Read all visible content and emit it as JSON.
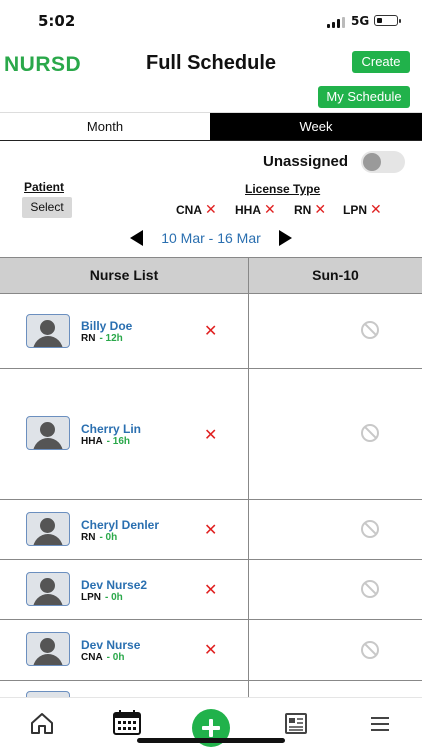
{
  "status_bar": {
    "time": "5:02",
    "network": "5G"
  },
  "header": {
    "brand": "NURSD",
    "title": "Full Schedule",
    "create_label": "Create",
    "my_schedule_label": "My Schedule"
  },
  "tabs": [
    {
      "label": "Month",
      "active": false
    },
    {
      "label": "Week",
      "active": true
    }
  ],
  "filters": {
    "unassigned_label": "Unassigned",
    "unassigned_on": false,
    "patient_label": "Patient",
    "select_label": "Select",
    "license_label": "License Type",
    "license_types": [
      "CNA",
      "HHA",
      "RN",
      "LPN"
    ]
  },
  "date_nav": {
    "range": "10 Mar - 16 Mar"
  },
  "grid": {
    "nurse_col_header": "Nurse List",
    "day_col_header": "Sun-10",
    "nurses": [
      {
        "name": "Billy Doe",
        "license": "RN",
        "hours": "- 12h"
      },
      {
        "name": "Cherry Lin",
        "license": "HHA",
        "hours": "- 16h"
      },
      {
        "name": "Cheryl Denler",
        "license": "RN",
        "hours": "- 0h"
      },
      {
        "name": "Dev Nurse2",
        "license": "LPN",
        "hours": "- 0h"
      },
      {
        "name": "Dev Nurse",
        "license": "CNA",
        "hours": "- 0h"
      }
    ]
  },
  "bottom_nav": [
    "home-icon",
    "calendar-icon",
    "add-icon",
    "news-icon",
    "menu-icon"
  ],
  "colors": {
    "brand_green": "#2aa84a",
    "button_green": "#21b24b",
    "link_blue": "#2a6fb0",
    "remove_red": "#e02020"
  }
}
